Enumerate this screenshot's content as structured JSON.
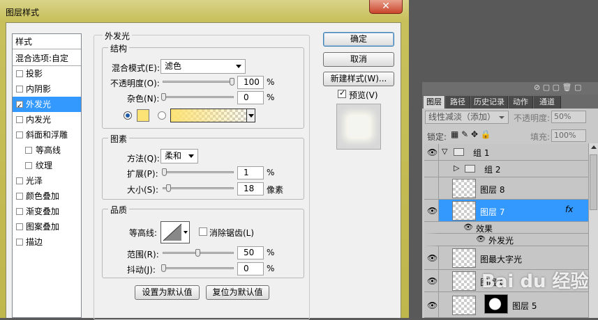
{
  "dialog": {
    "title": "图层样式",
    "close_glyph": "✕",
    "styles_header": "样式",
    "blend_options": "混合选项:自定",
    "style_items": [
      {
        "label": "投影",
        "checked": false
      },
      {
        "label": "内阴影",
        "checked": false
      },
      {
        "label": "外发光",
        "checked": true,
        "selected": true
      },
      {
        "label": "内发光",
        "checked": false
      },
      {
        "label": "斜面和浮雕",
        "checked": false
      },
      {
        "label": "等高线",
        "checked": false,
        "sub": true
      },
      {
        "label": "纹理",
        "checked": false,
        "sub": true
      },
      {
        "label": "光泽",
        "checked": false
      },
      {
        "label": "颜色叠加",
        "checked": false
      },
      {
        "label": "渐变叠加",
        "checked": false
      },
      {
        "label": "图案叠加",
        "checked": false
      },
      {
        "label": "描边",
        "checked": false
      }
    ],
    "section_title": "外发光",
    "structure": {
      "title": "结构",
      "blend_mode_label": "混合模式(E):",
      "blend_mode_value": "滤色",
      "opacity_label": "不透明度(O):",
      "opacity_value": "100",
      "opacity_level": 1.0,
      "noise_label": "杂色(N):",
      "noise_value": "0",
      "noise_level": 0.0,
      "percent": "%",
      "glow_color": "#fde275"
    },
    "elements": {
      "title": "图素",
      "method_label": "方法(Q):",
      "method_value": "柔和",
      "spread_label": "扩展(P):",
      "spread_value": "1",
      "spread_level": 0.01,
      "size_label": "大小(S):",
      "size_value": "18",
      "size_level": 0.07,
      "percent": "%",
      "px_unit": "像素"
    },
    "quality": {
      "title": "品质",
      "contour_label": "等高线:",
      "antialias_label": "消除锯齿(L)",
      "range_label": "范围(R):",
      "range_value": "50",
      "range_level": 0.5,
      "jitter_label": "抖动(J):",
      "jitter_value": "0",
      "jitter_level": 0.0,
      "percent": "%"
    },
    "set_default": "设置为默认值",
    "reset_default": "复位为默认值",
    "ok": "确定",
    "cancel": "取消",
    "new_style": "新建样式(W)...",
    "preview_label": "预览(V)",
    "preview_checked": true
  },
  "layers_panel": {
    "tabs": [
      "图层",
      "路径",
      "历史记录",
      "动作",
      "通道"
    ],
    "active_tab": 0,
    "blend_mode": "线性减淡（添加）",
    "opacity_label": "不透明度:",
    "opacity_value": "50%",
    "lock_label": "锁定:",
    "fill_label": "填充:",
    "fill_value": "100%",
    "fx_label": "fx",
    "layers": [
      {
        "name": "组 1",
        "type": "group-open",
        "visible": true
      },
      {
        "name": "组 2",
        "type": "group-closed",
        "visible": false
      },
      {
        "name": "图层 8",
        "type": "layer",
        "visible": false
      },
      {
        "name": "图层 7",
        "type": "layer",
        "visible": true,
        "selected": true
      },
      {
        "name": "效果",
        "type": "effects"
      },
      {
        "name": "外发光",
        "type": "effect"
      },
      {
        "name": "图最大字光",
        "type": "layer",
        "visible": true
      },
      {
        "name": "图层 6",
        "type": "layer",
        "visible": true
      },
      {
        "name": "图层 5",
        "type": "masked",
        "visible": true
      }
    ]
  },
  "watermark": "Bai du 经验"
}
